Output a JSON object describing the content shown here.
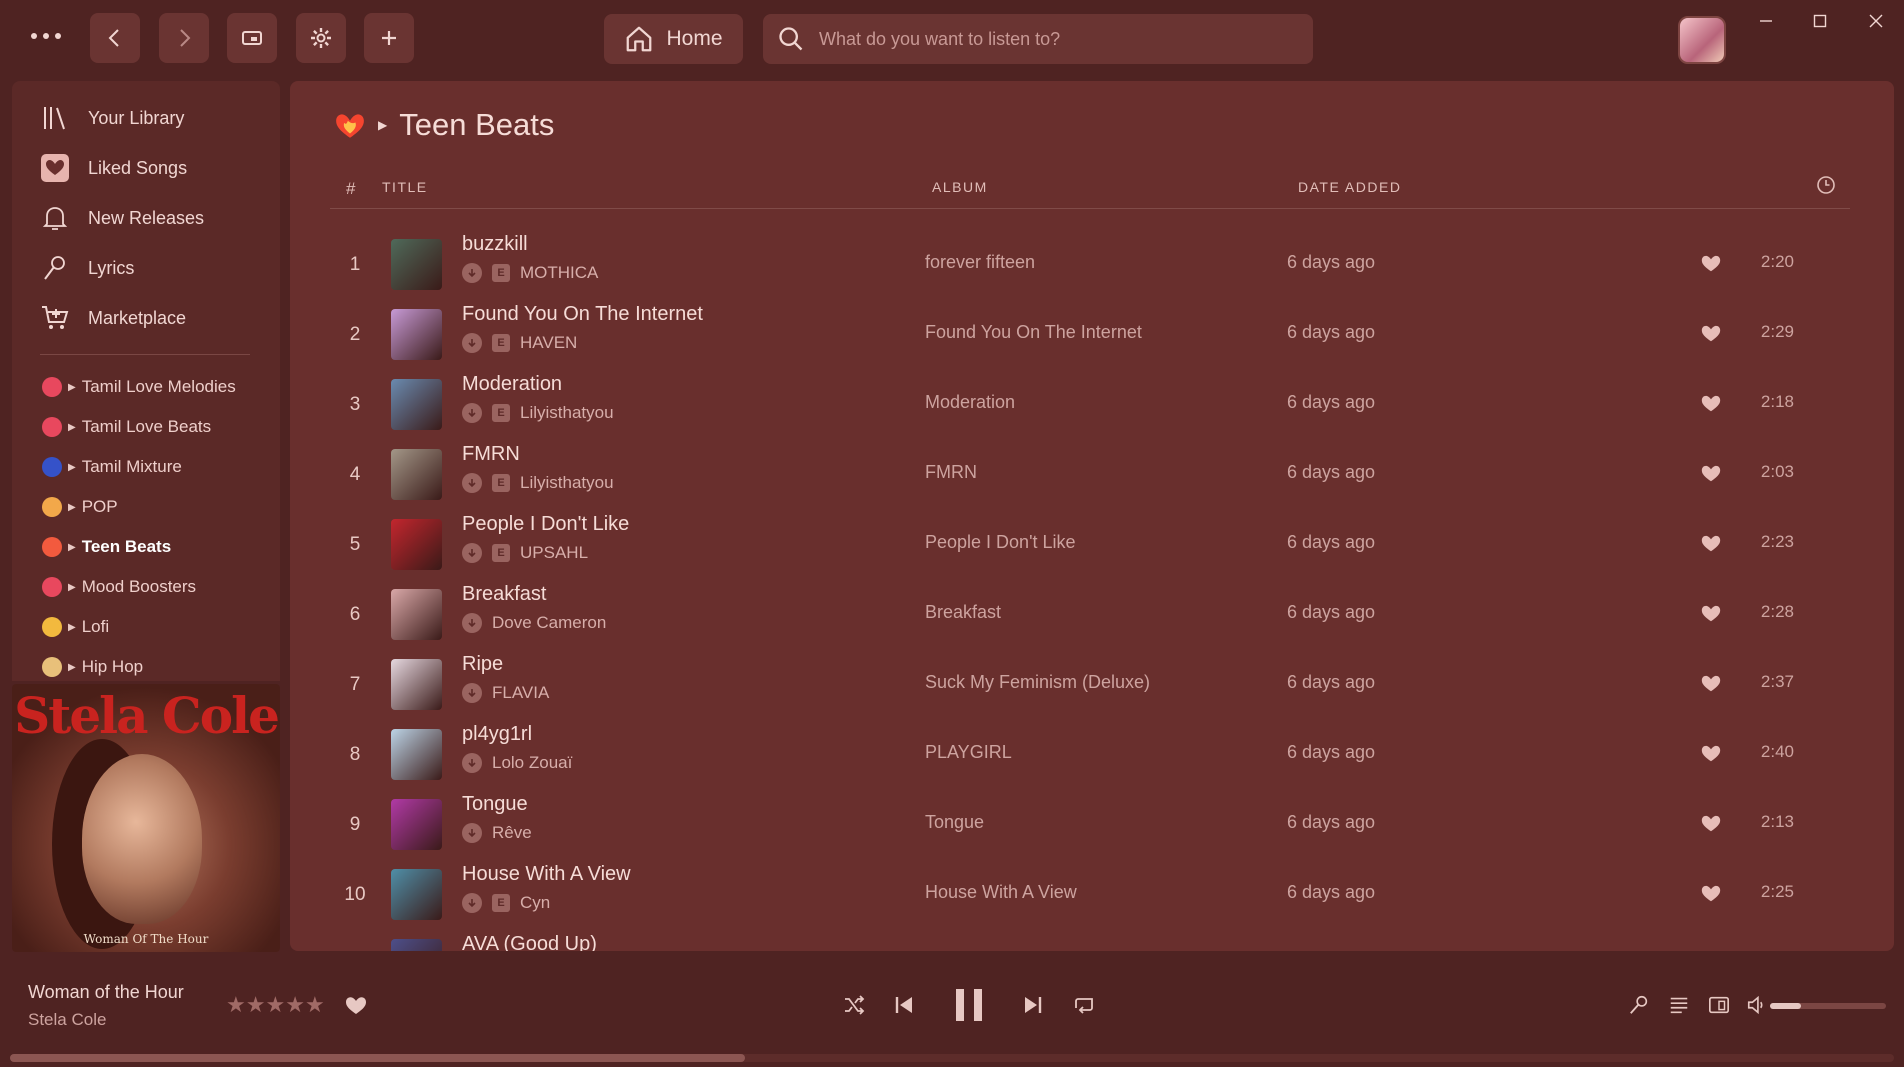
{
  "topbar": {
    "home_label": "Home",
    "search_placeholder": "What do you want to listen to?"
  },
  "sidebar": {
    "nav": [
      {
        "label": "Your Library",
        "icon": "library-icon"
      },
      {
        "label": "Liked Songs",
        "icon": "heart-square-icon"
      },
      {
        "label": "New Releases",
        "icon": "bell-icon"
      },
      {
        "label": "Lyrics",
        "icon": "microphone-icon"
      },
      {
        "label": "Marketplace",
        "icon": "cart-icon"
      }
    ],
    "playlists": [
      {
        "label": "Tamil Love Melodies",
        "color": "#e8485e"
      },
      {
        "label": "Tamil Love Beats",
        "color": "#e8485e"
      },
      {
        "label": "Tamil Mixture",
        "color": "#3552c9"
      },
      {
        "label": "POP",
        "color": "#f2a84a"
      },
      {
        "label": "Teen Beats",
        "color": "#f25a3e"
      },
      {
        "label": "Mood Boosters",
        "color": "#e8485e"
      },
      {
        "label": "Lofi",
        "color": "#f2b93e"
      },
      {
        "label": "Hip Hop",
        "color": "#e8c07a"
      }
    ],
    "cover": {
      "artist_text": "Stela Cole",
      "album_text": "Woman Of The Hour"
    }
  },
  "playlist": {
    "title": "Teen Beats",
    "columns": {
      "num": "#",
      "title": "TITLE",
      "album": "ALBUM",
      "date": "DATE ADDED"
    },
    "tracks": [
      {
        "n": "1",
        "title": "buzzkill",
        "artist": "MOTHICA",
        "explicit": true,
        "album": "forever fifteen",
        "date": "6 days ago",
        "dur": "2:20",
        "thumb": "#4f6a5a"
      },
      {
        "n": "2",
        "title": "Found You On The Internet",
        "artist": "HAVEN",
        "explicit": true,
        "album": "Found You On The Internet",
        "date": "6 days ago",
        "dur": "2:29",
        "thumb": "#c79ad6"
      },
      {
        "n": "3",
        "title": "Moderation",
        "artist": "Lilyisthatyou",
        "explicit": true,
        "album": "Moderation",
        "date": "6 days ago",
        "dur": "2:18",
        "thumb": "#6a8bb0"
      },
      {
        "n": "4",
        "title": "FMRN",
        "artist": "Lilyisthatyou",
        "explicit": true,
        "album": "FMRN",
        "date": "6 days ago",
        "dur": "2:03",
        "thumb": "#a39788"
      },
      {
        "n": "5",
        "title": "People I Don't Like",
        "artist": "UPSAHL",
        "explicit": true,
        "album": "People I Don't Like",
        "date": "6 days ago",
        "dur": "2:23",
        "thumb": "#c3262e"
      },
      {
        "n": "6",
        "title": "Breakfast",
        "artist": "Dove Cameron",
        "explicit": false,
        "album": "Breakfast",
        "date": "6 days ago",
        "dur": "2:28",
        "thumb": "#d9a8a8"
      },
      {
        "n": "7",
        "title": "Ripe",
        "artist": "FLAVIA",
        "explicit": false,
        "album": "Suck My Feminism (Deluxe)",
        "date": "6 days ago",
        "dur": "2:37",
        "thumb": "#e6d8e0"
      },
      {
        "n": "8",
        "title": "pl4yg1rl",
        "artist": "Lolo Zouaï",
        "explicit": false,
        "album": "PLAYGIRL",
        "date": "6 days ago",
        "dur": "2:40",
        "thumb": "#bcd4e6"
      },
      {
        "n": "9",
        "title": "Tongue",
        "artist": "Rêve",
        "explicit": false,
        "album": "Tongue",
        "date": "6 days ago",
        "dur": "2:13",
        "thumb": "#b13aa6"
      },
      {
        "n": "10",
        "title": "House With A View",
        "artist": "Cyn",
        "explicit": true,
        "album": "House With A View",
        "date": "6 days ago",
        "dur": "2:25",
        "thumb": "#4f8fa8"
      },
      {
        "n": "",
        "title": "AVA (Good Up)",
        "artist": "",
        "explicit": false,
        "album": "",
        "date": "",
        "dur": "",
        "thumb": "#4d4f8a"
      }
    ]
  },
  "player": {
    "title": "Woman of the Hour",
    "artist": "Stela Cole",
    "rating": 0,
    "progress": 0.39,
    "volume": 0.27
  }
}
